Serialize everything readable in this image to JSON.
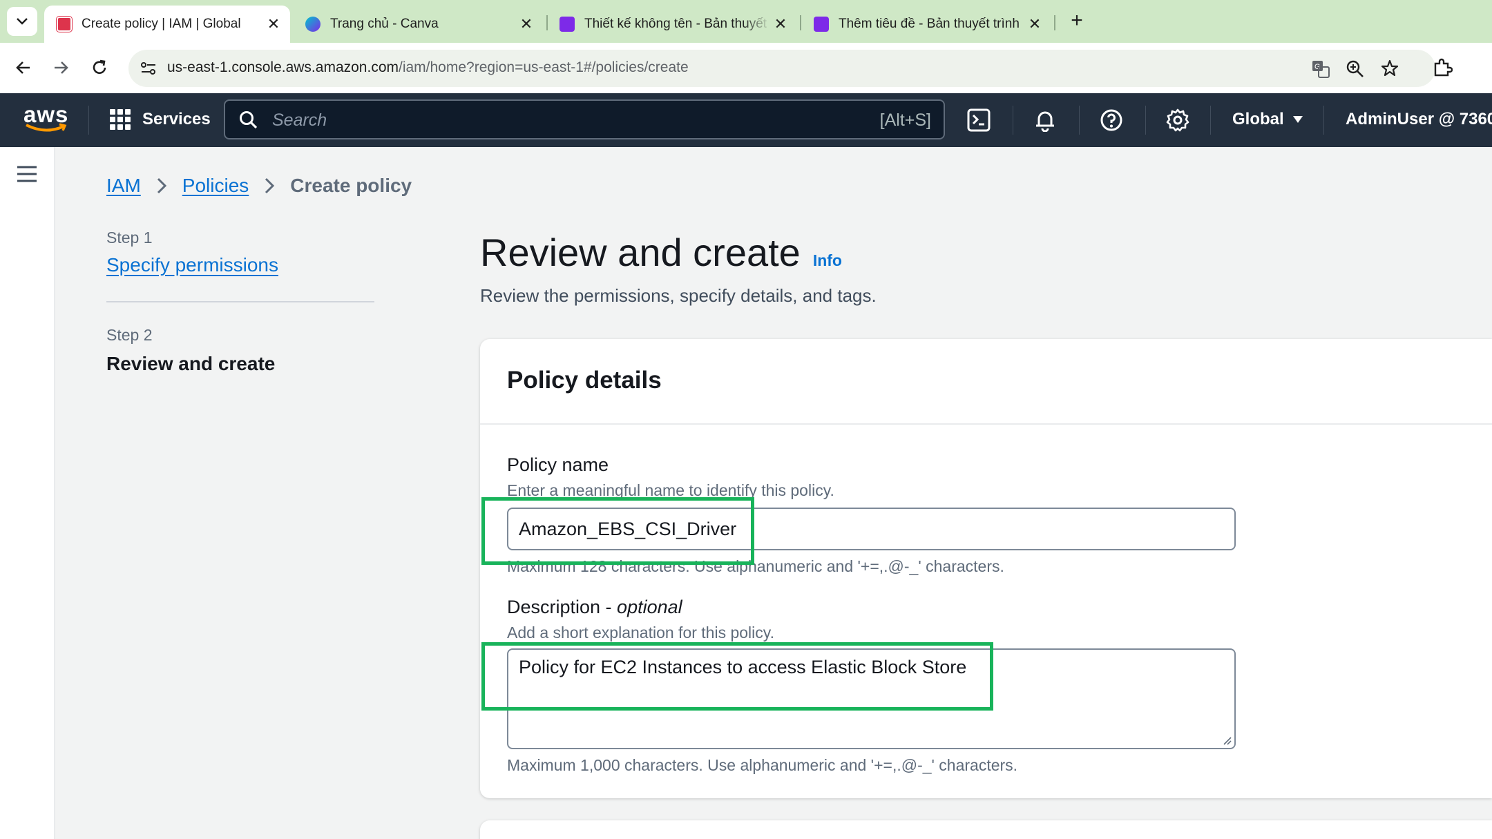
{
  "browser": {
    "tabs": [
      {
        "title": "Create policy | IAM | Global",
        "active": true
      },
      {
        "title": "Trang chủ - Canva",
        "active": false
      },
      {
        "title": "Thiết kế không tên - Bản thuyết",
        "active": false
      },
      {
        "title": "Thêm tiêu đề - Bản thuyết trình",
        "active": false
      }
    ],
    "url_host": "us-east-1.console.aws.amazon.com",
    "url_path": "/iam/home?region=us-east-1#/policies/create"
  },
  "aws_nav": {
    "logo_text": "aws",
    "services_label": "Services",
    "search_placeholder": "Search",
    "search_shortcut": "[Alt+S]",
    "region": "Global",
    "account": "AdminUser @ 7360-"
  },
  "breadcrumb": {
    "items": [
      "IAM",
      "Policies"
    ],
    "current": "Create policy"
  },
  "steps": [
    {
      "number": "Step 1",
      "label": "Specify permissions"
    },
    {
      "number": "Step 2",
      "label": "Review and create"
    }
  ],
  "page": {
    "title": "Review and create",
    "info": "Info",
    "description": "Review the permissions, specify details, and tags."
  },
  "policy_details": {
    "heading": "Policy details",
    "name_label": "Policy name",
    "name_hint": "Enter a meaningful name to identify this policy.",
    "name_value": "Amazon_EBS_CSI_Driver",
    "name_constraint": "Maximum 128 characters. Use alphanumeric and '+=,.@-_' characters.",
    "desc_label": "Description - ",
    "desc_optional": "optional",
    "desc_hint": "Add a short explanation for this policy.",
    "desc_value": "Policy for EC2 Instances to access Elastic Block Store",
    "desc_constraint": "Maximum 1,000 characters. Use alphanumeric and '+=,.@-_' characters."
  },
  "colors": {
    "aws_nav_bg": "#232f3e",
    "link": "#0972d3",
    "highlight": "#18b35a",
    "aws_orange": "#ff9900"
  }
}
